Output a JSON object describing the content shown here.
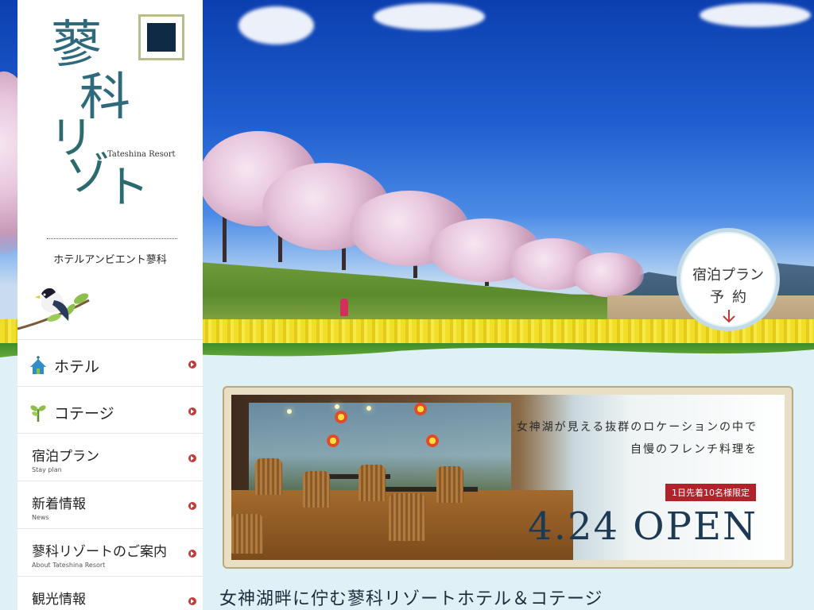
{
  "brand": {
    "logo_kanji": [
      "蓼",
      "科"
    ],
    "logo_kana": [
      "リ",
      "ゾ",
      "ー",
      "ト"
    ],
    "logo_en": "Tateshina Resort",
    "hotel_name": "ホテルアンビエント蓼科"
  },
  "nav": {
    "items": [
      {
        "label": "ホテル",
        "icon": "house-icon"
      },
      {
        "label": "コテージ",
        "icon": "sprout-icon"
      },
      {
        "label": "宿泊プラン",
        "sub": "Stay plan"
      },
      {
        "label": "新着情報",
        "sub": "News"
      },
      {
        "label": "蓼科リゾートのご案内",
        "sub": "About Tateshina Resort"
      },
      {
        "label": "観光情報",
        "sub": ""
      }
    ]
  },
  "reserve": {
    "line1": "宿泊プラン",
    "line2": "予約"
  },
  "banner": {
    "line1": "女神湖が見える抜群のロケーションの中で",
    "line2": "自慢のフレンチ料理を",
    "badge": "1日先着10名様限定",
    "open": "4.24 OPEN"
  },
  "tagline": "女神湖畔に佇む蓼科リゾートホテル＆コテージ",
  "colors": {
    "accent_red": "#c33a3a",
    "navy": "#1d3a55",
    "logo_teal": "#2e6a7c"
  }
}
